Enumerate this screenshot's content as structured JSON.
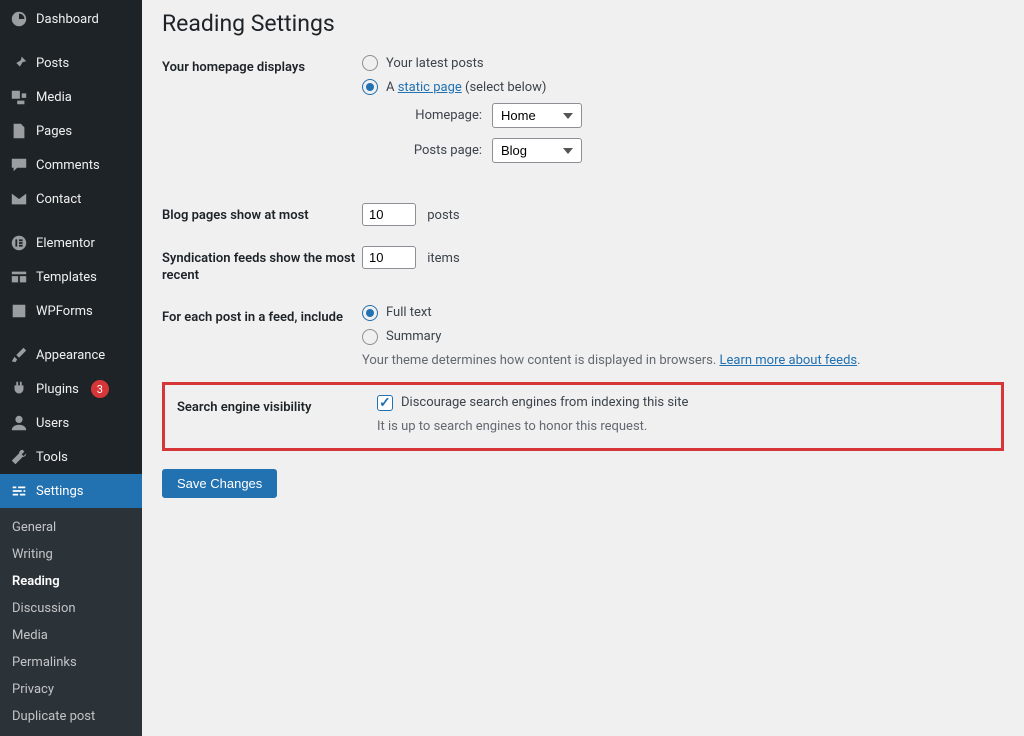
{
  "sidebar": {
    "items": [
      {
        "label": "Dashboard"
      },
      {
        "label": "Posts"
      },
      {
        "label": "Media"
      },
      {
        "label": "Pages"
      },
      {
        "label": "Comments"
      },
      {
        "label": "Contact"
      },
      {
        "label": "Elementor"
      },
      {
        "label": "Templates"
      },
      {
        "label": "WPForms"
      },
      {
        "label": "Appearance"
      },
      {
        "label": "Plugins",
        "badge": "3"
      },
      {
        "label": "Users"
      },
      {
        "label": "Tools"
      },
      {
        "label": "Settings"
      }
    ],
    "submenu": [
      "General",
      "Writing",
      "Reading",
      "Discussion",
      "Media",
      "Permalinks",
      "Privacy",
      "Duplicate post"
    ],
    "submenu_active": "Reading"
  },
  "page": {
    "title": "Reading Settings",
    "homepage_displays": {
      "label": "Your homepage displays",
      "opt_latest": "Your latest posts",
      "opt_static_prefix": "A ",
      "opt_static_link": "static page",
      "opt_static_suffix": " (select below)",
      "selected": "static",
      "homepage_label": "Homepage:",
      "homepage_value": "Home",
      "postspage_label": "Posts page:",
      "postspage_value": "Blog"
    },
    "blog_pages": {
      "label": "Blog pages show at most",
      "value": "10",
      "unit": "posts"
    },
    "syndication": {
      "label": "Syndication feeds show the most recent",
      "value": "10",
      "unit": "items"
    },
    "feed_include": {
      "label": "For each post in a feed, include",
      "opt_full": "Full text",
      "opt_summary": "Summary",
      "selected": "full",
      "desc_prefix": "Your theme determines how content is displayed in browsers. ",
      "desc_link": "Learn more about feeds"
    },
    "search_visibility": {
      "label": "Search engine visibility",
      "checkbox_label": "Discourage search engines from indexing this site",
      "checked": true,
      "note": "It is up to search engines to honor this request."
    },
    "save_button": "Save Changes"
  }
}
